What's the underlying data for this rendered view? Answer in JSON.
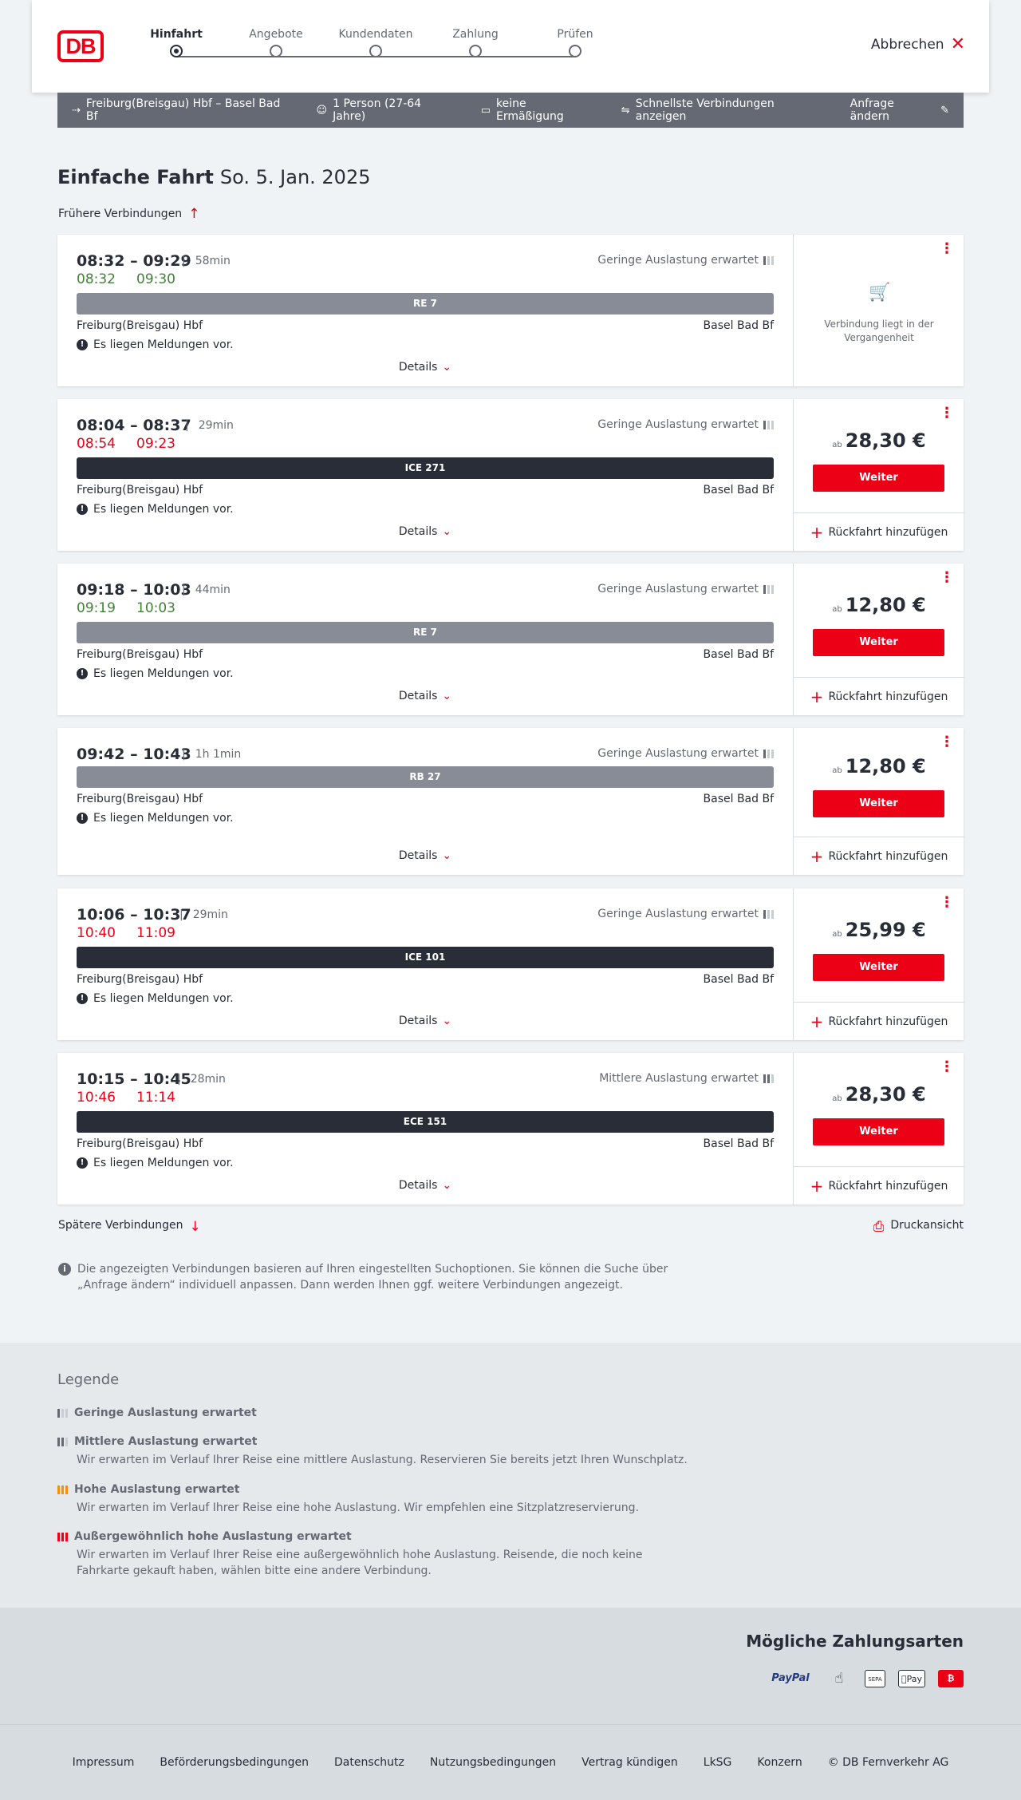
{
  "header": {
    "logo_text": "DB",
    "steps": [
      "Hinfahrt",
      "Angebote",
      "Kundendaten",
      "Zahlung",
      "Prüfen"
    ],
    "cancel_label": "Abbrechen"
  },
  "search": {
    "route": "Freiburg(Breisgau) Hbf – Basel Bad Bf",
    "passengers": "1 Person (27-64 Jahre)",
    "discount": "keine Ermäßigung",
    "fastest": "Schnellste Verbindungen anzeigen",
    "change": "Anfrage ändern"
  },
  "page": {
    "title": "Einfache Fahrt",
    "date": "So. 5. Jan. 2025",
    "earlier": "Frühere Verbindungen",
    "later": "Spätere Verbindungen",
    "print": "Druckansicht",
    "info": "Die angezeigten Verbindungen basieren auf Ihren eingestellten Suchoptionen. Sie können die Suche über „Anfrage ändern“ individuell anpassen. Dann werden Ihnen ggf. weitere Verbindungen angezeigt."
  },
  "labels": {
    "details": "Details",
    "message": "Es liegen Meldungen vor.",
    "weiter": "Weiter",
    "ab": "ab",
    "return": "Rückfahrt hinzufügen",
    "past": "Verbindung liegt in der Vergangenheit"
  },
  "connections": [
    {
      "times": "08:32 – 09:29",
      "duration": "58min",
      "rt_dep": "08:32",
      "rt_arr": "09:30",
      "rt_color": "green",
      "occupancy": "Geringe Auslastung erwartet",
      "train": "RE 7",
      "train_type": "regio",
      "from": "Freiburg(Breisgau) Hbf",
      "to": "Basel Bad Bf",
      "price": "",
      "past": true
    },
    {
      "times": "08:04 – 08:37",
      "duration": "29min",
      "rt_dep": "08:54",
      "rt_arr": "09:23",
      "rt_color": "red",
      "occupancy": "Geringe Auslastung erwartet",
      "train": "ICE 271",
      "train_type": "fern",
      "from": "Freiburg(Breisgau) Hbf",
      "to": "Basel Bad Bf",
      "price": "28,30 €",
      "past": false
    },
    {
      "times": "09:18 – 10:03",
      "duration": "44min",
      "rt_dep": "09:19",
      "rt_arr": "10:03",
      "rt_color": "green",
      "occupancy": "Geringe Auslastung erwartet",
      "train": "RE 7",
      "train_type": "regio",
      "from": "Freiburg(Breisgau) Hbf",
      "to": "Basel Bad Bf",
      "price": "12,80 €",
      "past": false
    },
    {
      "times": "09:42 – 10:43",
      "duration": "1h 1min",
      "rt_dep": "",
      "rt_arr": "",
      "rt_color": "green",
      "occupancy": "Geringe Auslastung erwartet",
      "train": "RB 27",
      "train_type": "regio",
      "from": "Freiburg(Breisgau) Hbf",
      "to": "Basel Bad Bf",
      "price": "12,80 €",
      "past": false
    },
    {
      "times": "10:06 – 10:37",
      "duration": "29min",
      "rt_dep": "10:40",
      "rt_arr": "11:09",
      "rt_color": "red",
      "occupancy": "Geringe Auslastung erwartet",
      "train": "ICE 101",
      "train_type": "fern",
      "from": "Freiburg(Breisgau) Hbf",
      "to": "Basel Bad Bf",
      "price": "25,99 €",
      "past": false
    },
    {
      "times": "10:15 – 10:45",
      "duration": "28min",
      "rt_dep": "10:46",
      "rt_arr": "11:14",
      "rt_color": "red",
      "occupancy": "Mittlere Auslastung erwartet",
      "train": "ECE 151",
      "train_type": "fern",
      "from": "Freiburg(Breisgau) Hbf",
      "to": "Basel Bad Bf",
      "price": "28,30 €",
      "past": false
    }
  ],
  "legend": {
    "title": "Legende",
    "items": [
      {
        "head": "Geringe Auslastung erwartet",
        "text": "",
        "level": 1,
        "color": "#646973"
      },
      {
        "head": "Mittlere Auslastung erwartet",
        "text": "Wir erwarten im Verlauf Ihrer Reise eine mittlere Auslastung. Reservieren Sie bereits jetzt Ihren Wunschplatz.",
        "level": 2,
        "color": "#646973"
      },
      {
        "head": "Hohe Auslastung erwartet",
        "text": "Wir erwarten im Verlauf Ihrer Reise eine hohe Auslastung. Wir empfehlen eine Sitzplatzreservierung.",
        "level": 3,
        "color": "#f39200"
      },
      {
        "head": "Außergewöhnlich hohe Auslastung erwartet",
        "text": "Wir erwarten im Verlauf Ihrer Reise eine außergewöhnlich hohe Auslastung. Reisende, die noch keine Fahrkarte gekauft haben, wählen bitte eine andere Verbindung.",
        "level": 4,
        "color": "#ec0016"
      }
    ]
  },
  "payment": {
    "title": "Mögliche Zahlungsarten",
    "paypal": "PayPal",
    "sepa": "SEPA",
    "apple": "Pay"
  },
  "footer": [
    "Impressum",
    "Beförderungsbedingungen",
    "Datenschutz",
    "Nutzungsbedingungen",
    "Vertrag kündigen",
    "LkSG",
    "Konzern",
    "© DB Fernverkehr AG"
  ]
}
